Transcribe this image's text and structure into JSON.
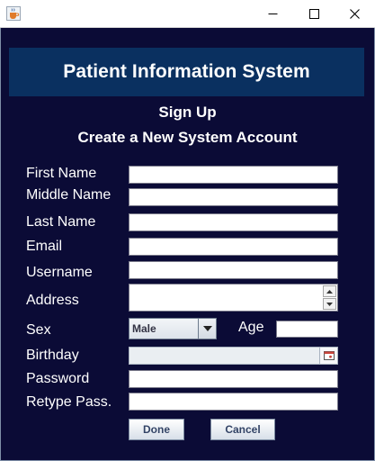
{
  "window": {
    "icon": "java-cup-icon",
    "controls": [
      "minimize-icon",
      "maximize-icon",
      "close-icon"
    ]
  },
  "header": {
    "title": "Patient Information System"
  },
  "form": {
    "subtitle": "Sign Up",
    "heading": "Create a New System Account",
    "labels": {
      "first_name": "First Name",
      "middle_name": "Middle Name",
      "last_name": "Last Name",
      "email": "Email",
      "username": "Username",
      "address": "Address",
      "sex": "Sex",
      "age": "Age",
      "birthday": "Birthday",
      "password": "Password",
      "retype_password": "Retype Pass."
    },
    "values": {
      "first_name": "",
      "middle_name": "",
      "last_name": "",
      "email": "",
      "username": "",
      "address": "",
      "sex": "Male",
      "age": "",
      "birthday": "",
      "password": "",
      "retype_password": ""
    }
  },
  "buttons": {
    "done": "Done",
    "cancel": "Cancel"
  },
  "colors": {
    "background": "#0b0b36",
    "banner": "#0a3060",
    "text": "#ffffff"
  }
}
